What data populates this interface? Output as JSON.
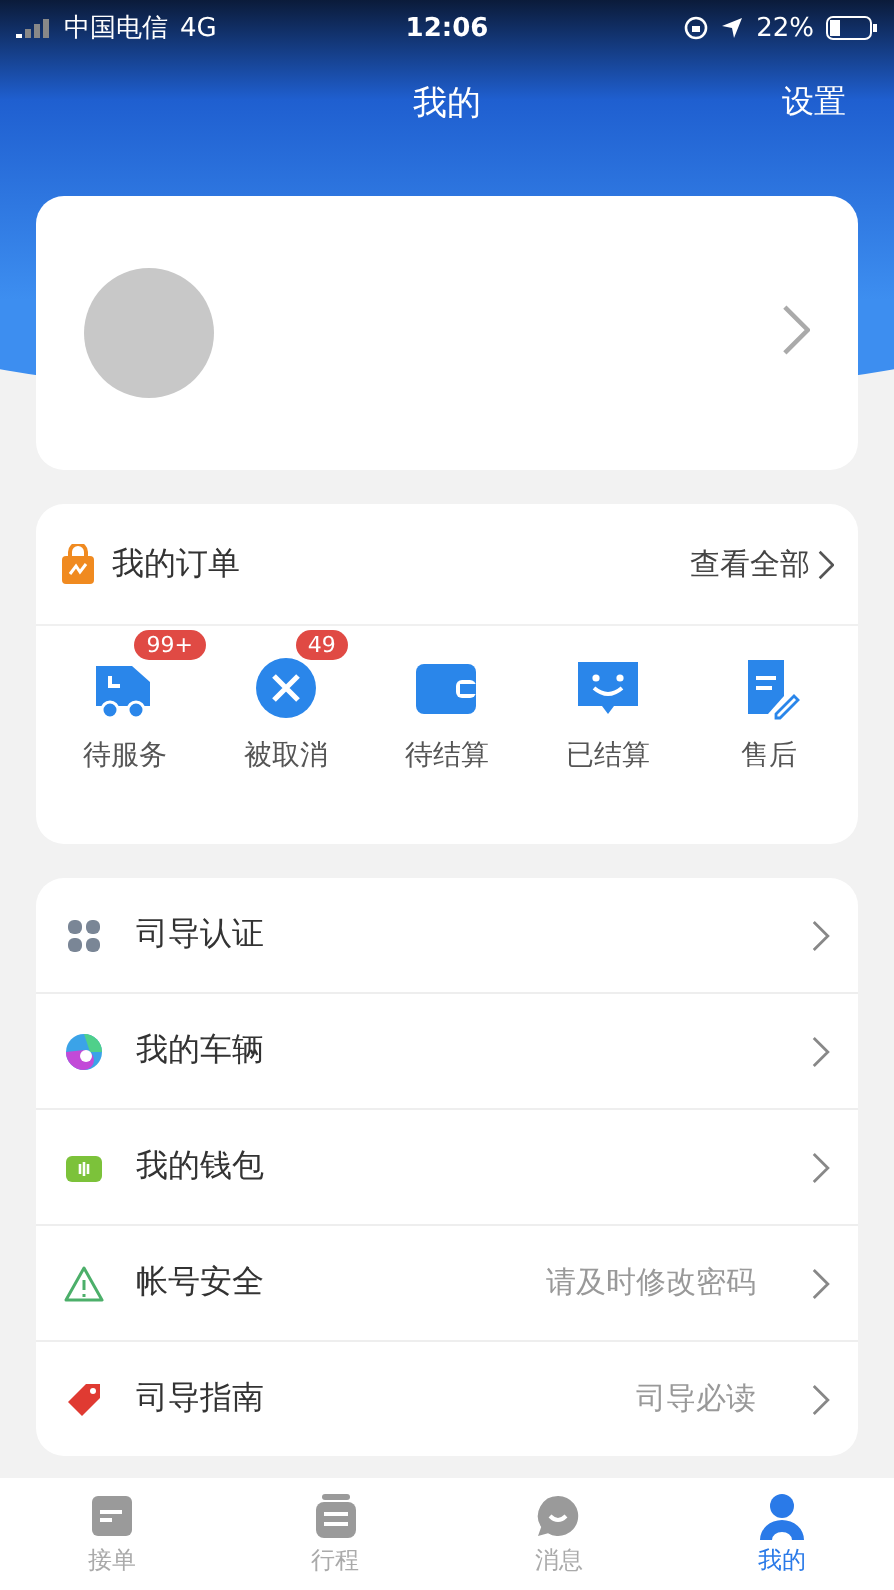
{
  "status_bar": {
    "carrier": "中国电信",
    "network": "4G",
    "time": "12:06",
    "battery": "22%"
  },
  "header": {
    "title": "我的",
    "action": "设置"
  },
  "orders": {
    "title": "我的订单",
    "view_all": "查看全部",
    "items": [
      {
        "kind": "truck",
        "label": "待服务",
        "badge": "99+"
      },
      {
        "kind": "cancel",
        "label": "被取消",
        "badge": "49"
      },
      {
        "kind": "wallet",
        "label": "待结算"
      },
      {
        "kind": "smile",
        "label": "已结算"
      },
      {
        "kind": "note",
        "label": "售后"
      }
    ]
  },
  "menu": [
    {
      "kind": "grid",
      "label": "司导认证"
    },
    {
      "kind": "swirl",
      "label": "我的车辆"
    },
    {
      "kind": "purse",
      "label": "我的钱包"
    },
    {
      "kind": "warning",
      "label": "帐号安全",
      "hint": "请及时修改密码"
    },
    {
      "kind": "tag",
      "label": "司导指南",
      "hint": "司导必读"
    }
  ],
  "tab_bar": [
    {
      "kind": "orders",
      "label": "接单",
      "selected": false
    },
    {
      "kind": "trips",
      "label": "行程",
      "selected": false
    },
    {
      "kind": "messages",
      "label": "消息",
      "selected": false
    },
    {
      "kind": "profile",
      "label": "我的",
      "selected": true
    }
  ]
}
